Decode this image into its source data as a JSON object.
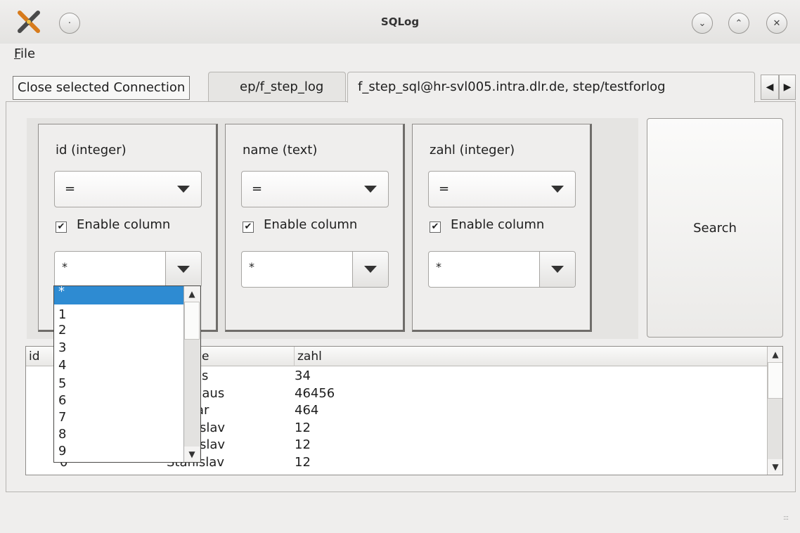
{
  "window": {
    "title": "SQLog",
    "controls": [
      "minimize",
      "maximize",
      "close"
    ]
  },
  "menubar": {
    "file_mnemonic": "F",
    "file_rest": "ile"
  },
  "tabs": [
    {
      "label": "ep/f_step_log",
      "active": false
    },
    {
      "label": "f_step_sql@hr-svl005.intra.dlr.de, step/testforlog",
      "active": true
    }
  ],
  "tooltip": "Close selected Connection",
  "filters": [
    {
      "title": "id (integer)",
      "operator": "=",
      "enable_label": "Enable column",
      "enabled": true,
      "value": "*"
    },
    {
      "title": "name (text)",
      "operator": "=",
      "enable_label": "Enable column",
      "enabled": true,
      "value": "*"
    },
    {
      "title": "zahl (integer)",
      "operator": "=",
      "enable_label": "Enable column",
      "enabled": true,
      "value": "*"
    }
  ],
  "search_label": "Search",
  "dropdown": {
    "options": [
      "*",
      "1",
      "2",
      "3",
      "4",
      "5",
      "6",
      "7",
      "8",
      "9"
    ],
    "selected": "*"
  },
  "table": {
    "columns": [
      "id",
      "e",
      "zahl"
    ],
    "name_col": [
      "s",
      "slaus",
      "ar",
      "islav",
      "islav",
      "Stanislav"
    ],
    "zahl_col": [
      "34",
      "46456",
      "464",
      "12",
      "12",
      "12"
    ],
    "partial_id": "0"
  }
}
